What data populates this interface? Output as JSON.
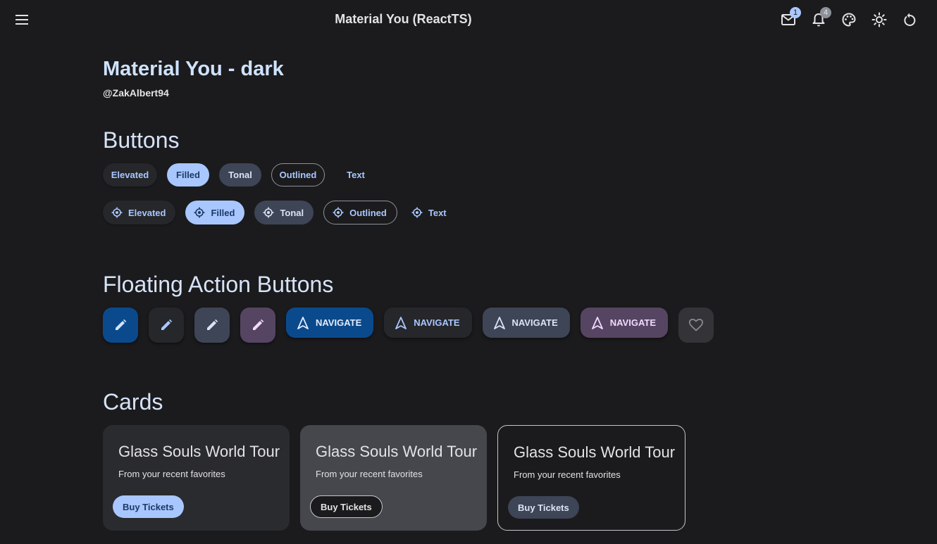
{
  "app_bar": {
    "title": "Material You (ReactTS)",
    "icons": [
      "menu-icon",
      "mail-icon",
      "bell-icon",
      "palette-icon",
      "sun-icon",
      "refresh-icon"
    ],
    "mail_badge": "1",
    "notifications_badge": "4"
  },
  "header": {
    "title": "Material You - dark",
    "handle": "@ZakAlbert94"
  },
  "buttons": {
    "section_title": "Buttons",
    "row1": [
      "Elevated",
      "Filled",
      "Tonal",
      "Outlined",
      "Text"
    ],
    "row2": [
      "Elevated",
      "Filled",
      "Tonal",
      "Outlined",
      "Text"
    ],
    "row2_icon": "target-icon"
  },
  "fabs": {
    "section_title": "Floating Action Buttons",
    "fab_icon": "pencil-icon",
    "extended_label": "NAVIGATE",
    "extended_icon": "navigation-arrow-icon",
    "disabled_icon": "heart-icon"
  },
  "cards": {
    "section_title": "Cards",
    "items": [
      {
        "title": "Glass Souls World Tour",
        "subtitle": "From your recent favorites",
        "button": "Buy Tickets"
      },
      {
        "title": "Glass Souls World Tour",
        "subtitle": "From your recent favorites",
        "button": "Buy Tickets"
      },
      {
        "title": "Glass Souls World Tour",
        "subtitle": "From your recent favorites",
        "button": "Buy Tickets"
      }
    ]
  },
  "colors": {
    "background": "#1b1b1d",
    "primary": "#a9c7ff",
    "primary_container": "#0a4a8c",
    "secondary_container": "#3d4556",
    "tertiary_container": "#564562"
  }
}
